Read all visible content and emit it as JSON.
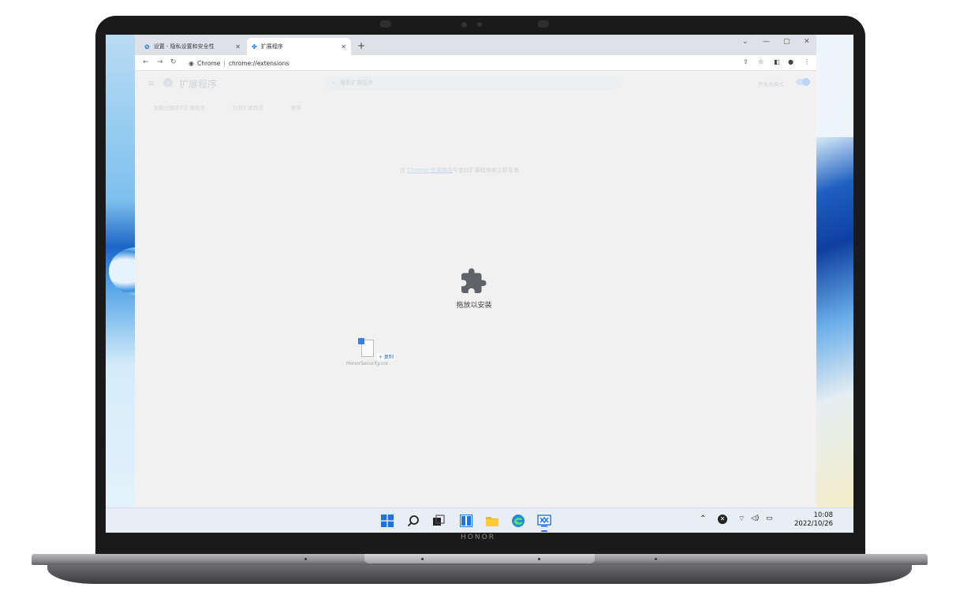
{
  "device": {
    "brand": "HONOR"
  },
  "browser": {
    "tabs": [
      {
        "label": "设置 - 隐私设置和安全性",
        "icon": "gear-icon",
        "active": false
      },
      {
        "label": "扩展程序",
        "icon": "puzzle-icon",
        "active": true
      }
    ],
    "omnibox": {
      "site_label": "Chrome",
      "url": "chrome://extensions"
    }
  },
  "extensions_page": {
    "title": "扩展程序",
    "search_placeholder": "搜索扩展程序",
    "developer_mode_label": "开发者模式",
    "subnav": [
      "加载已解压的扩展程序",
      "打包扩展程序",
      "更新"
    ],
    "hint_prefix": "在",
    "hint_link": "Chrome 应用商店",
    "hint_suffix": "中查找扩展程序和主题背景",
    "drop_label": "拖放以安装"
  },
  "drag_item": {
    "file_name": "HonorSecurity.crx",
    "copy_label": "+ 复制"
  },
  "taskbar": {
    "apps": [
      "start-icon",
      "search-icon",
      "task-view-icon",
      "widgets-icon",
      "file-explorer-icon",
      "edge-icon",
      "remote-app-icon"
    ],
    "time": "10:08",
    "date": "2022/10/26"
  },
  "colors": {
    "accent": "#1a73e8",
    "page_bg": "#f1f1f2",
    "taskbar_bg": "#e8eef6"
  }
}
